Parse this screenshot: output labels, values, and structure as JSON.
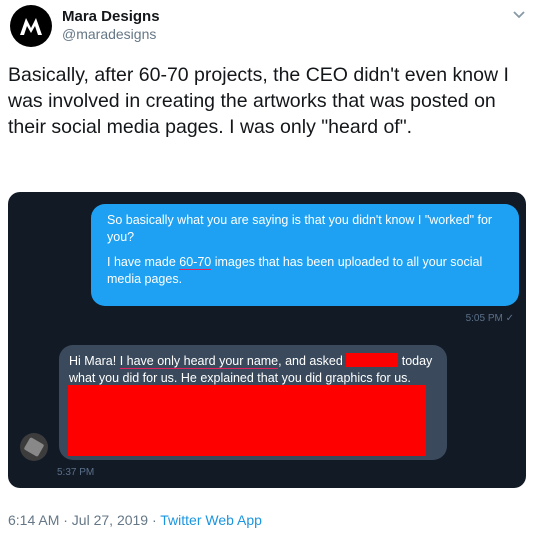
{
  "author": {
    "name": "Mara Designs",
    "handle": "@maradesigns"
  },
  "tweet_text": "Basically, after 60-70 projects, the CEO didn't even know I was involved in creating the artworks that was posted on their social media pages. I was only \"heard of\".",
  "media": {
    "outgoing": {
      "para1": "So basically what you are saying is that you didn't know I \"worked\" for you?",
      "para2_before": "I have made ",
      "para2_underlined": "60-70",
      "para2_after": " images that has been uploaded to all your social media pages.",
      "timestamp": "5:05 PM",
      "status_icon": "check-icon"
    },
    "incoming": {
      "text_start": "Hi Mara! ",
      "text_underlined": "I have only heard your name",
      "text_mid": ", and asked ",
      "text_end": " today what you did for us. He explained that you did graphics for us.",
      "timestamp": "5:37 PM",
      "redaction_color": "#ff0000"
    }
  },
  "meta": {
    "datetime": "6:14 AM · Jul 27, 2019 · ",
    "source": "Twitter Web App"
  },
  "colors": {
    "dm_background": "#121a26",
    "outgoing_bubble": "#1ea1f2",
    "incoming_bubble": "#3a4a5c",
    "link": "#1b95e0"
  }
}
